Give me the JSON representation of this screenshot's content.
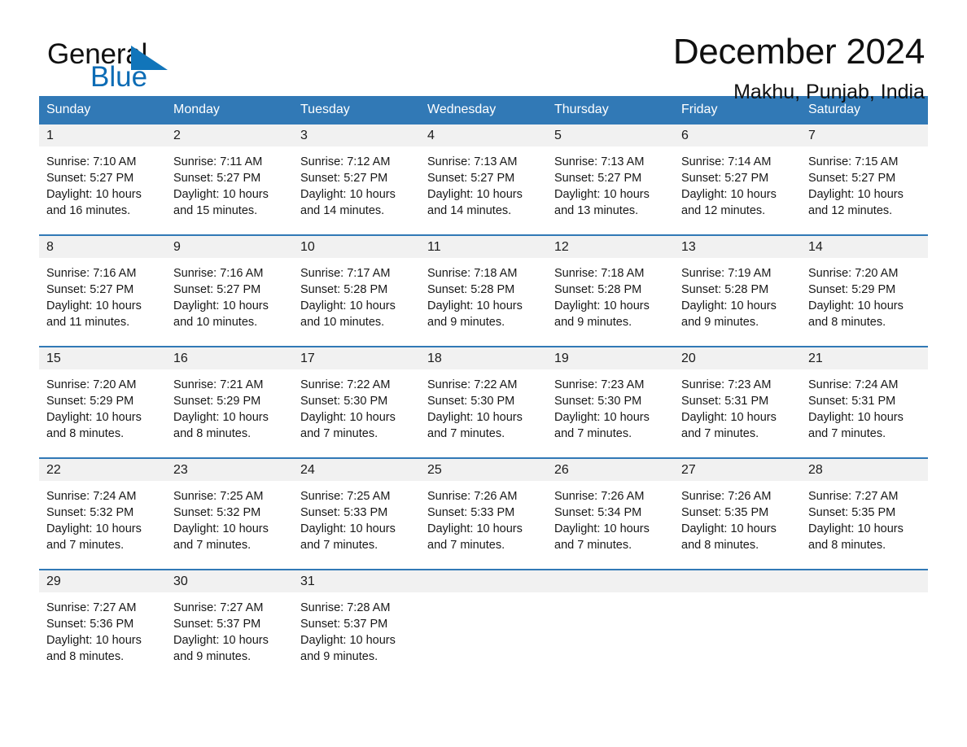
{
  "brand": {
    "word_one": "General",
    "word_two": "Blue",
    "logo_icon": "triangle-flag-icon"
  },
  "header": {
    "title": "December 2024",
    "subtitle": "Makhu, Punjab, India"
  },
  "colors": {
    "header_blue": "#3179b6",
    "brand_blue": "#0c6cb5",
    "date_band": "#f1f1f1",
    "text": "#181818"
  },
  "weekdays": [
    "Sunday",
    "Monday",
    "Tuesday",
    "Wednesday",
    "Thursday",
    "Friday",
    "Saturday"
  ],
  "weeks": [
    {
      "days": [
        {
          "date": "1",
          "lines": [
            "Sunrise: 7:10 AM",
            "Sunset: 5:27 PM",
            "Daylight: 10 hours",
            "and 16 minutes."
          ]
        },
        {
          "date": "2",
          "lines": [
            "Sunrise: 7:11 AM",
            "Sunset: 5:27 PM",
            "Daylight: 10 hours",
            "and 15 minutes."
          ]
        },
        {
          "date": "3",
          "lines": [
            "Sunrise: 7:12 AM",
            "Sunset: 5:27 PM",
            "Daylight: 10 hours",
            "and 14 minutes."
          ]
        },
        {
          "date": "4",
          "lines": [
            "Sunrise: 7:13 AM",
            "Sunset: 5:27 PM",
            "Daylight: 10 hours",
            "and 14 minutes."
          ]
        },
        {
          "date": "5",
          "lines": [
            "Sunrise: 7:13 AM",
            "Sunset: 5:27 PM",
            "Daylight: 10 hours",
            "and 13 minutes."
          ]
        },
        {
          "date": "6",
          "lines": [
            "Sunrise: 7:14 AM",
            "Sunset: 5:27 PM",
            "Daylight: 10 hours",
            "and 12 minutes."
          ]
        },
        {
          "date": "7",
          "lines": [
            "Sunrise: 7:15 AM",
            "Sunset: 5:27 PM",
            "Daylight: 10 hours",
            "and 12 minutes."
          ]
        }
      ]
    },
    {
      "days": [
        {
          "date": "8",
          "lines": [
            "Sunrise: 7:16 AM",
            "Sunset: 5:27 PM",
            "Daylight: 10 hours",
            "and 11 minutes."
          ]
        },
        {
          "date": "9",
          "lines": [
            "Sunrise: 7:16 AM",
            "Sunset: 5:27 PM",
            "Daylight: 10 hours",
            "and 10 minutes."
          ]
        },
        {
          "date": "10",
          "lines": [
            "Sunrise: 7:17 AM",
            "Sunset: 5:28 PM",
            "Daylight: 10 hours",
            "and 10 minutes."
          ]
        },
        {
          "date": "11",
          "lines": [
            "Sunrise: 7:18 AM",
            "Sunset: 5:28 PM",
            "Daylight: 10 hours",
            "and 9 minutes."
          ]
        },
        {
          "date": "12",
          "lines": [
            "Sunrise: 7:18 AM",
            "Sunset: 5:28 PM",
            "Daylight: 10 hours",
            "and 9 minutes."
          ]
        },
        {
          "date": "13",
          "lines": [
            "Sunrise: 7:19 AM",
            "Sunset: 5:28 PM",
            "Daylight: 10 hours",
            "and 9 minutes."
          ]
        },
        {
          "date": "14",
          "lines": [
            "Sunrise: 7:20 AM",
            "Sunset: 5:29 PM",
            "Daylight: 10 hours",
            "and 8 minutes."
          ]
        }
      ]
    },
    {
      "days": [
        {
          "date": "15",
          "lines": [
            "Sunrise: 7:20 AM",
            "Sunset: 5:29 PM",
            "Daylight: 10 hours",
            "and 8 minutes."
          ]
        },
        {
          "date": "16",
          "lines": [
            "Sunrise: 7:21 AM",
            "Sunset: 5:29 PM",
            "Daylight: 10 hours",
            "and 8 minutes."
          ]
        },
        {
          "date": "17",
          "lines": [
            "Sunrise: 7:22 AM",
            "Sunset: 5:30 PM",
            "Daylight: 10 hours",
            "and 7 minutes."
          ]
        },
        {
          "date": "18",
          "lines": [
            "Sunrise: 7:22 AM",
            "Sunset: 5:30 PM",
            "Daylight: 10 hours",
            "and 7 minutes."
          ]
        },
        {
          "date": "19",
          "lines": [
            "Sunrise: 7:23 AM",
            "Sunset: 5:30 PM",
            "Daylight: 10 hours",
            "and 7 minutes."
          ]
        },
        {
          "date": "20",
          "lines": [
            "Sunrise: 7:23 AM",
            "Sunset: 5:31 PM",
            "Daylight: 10 hours",
            "and 7 minutes."
          ]
        },
        {
          "date": "21",
          "lines": [
            "Sunrise: 7:24 AM",
            "Sunset: 5:31 PM",
            "Daylight: 10 hours",
            "and 7 minutes."
          ]
        }
      ]
    },
    {
      "days": [
        {
          "date": "22",
          "lines": [
            "Sunrise: 7:24 AM",
            "Sunset: 5:32 PM",
            "Daylight: 10 hours",
            "and 7 minutes."
          ]
        },
        {
          "date": "23",
          "lines": [
            "Sunrise: 7:25 AM",
            "Sunset: 5:32 PM",
            "Daylight: 10 hours",
            "and 7 minutes."
          ]
        },
        {
          "date": "24",
          "lines": [
            "Sunrise: 7:25 AM",
            "Sunset: 5:33 PM",
            "Daylight: 10 hours",
            "and 7 minutes."
          ]
        },
        {
          "date": "25",
          "lines": [
            "Sunrise: 7:26 AM",
            "Sunset: 5:33 PM",
            "Daylight: 10 hours",
            "and 7 minutes."
          ]
        },
        {
          "date": "26",
          "lines": [
            "Sunrise: 7:26 AM",
            "Sunset: 5:34 PM",
            "Daylight: 10 hours",
            "and 7 minutes."
          ]
        },
        {
          "date": "27",
          "lines": [
            "Sunrise: 7:26 AM",
            "Sunset: 5:35 PM",
            "Daylight: 10 hours",
            "and 8 minutes."
          ]
        },
        {
          "date": "28",
          "lines": [
            "Sunrise: 7:27 AM",
            "Sunset: 5:35 PM",
            "Daylight: 10 hours",
            "and 8 minutes."
          ]
        }
      ]
    },
    {
      "days": [
        {
          "date": "29",
          "lines": [
            "Sunrise: 7:27 AM",
            "Sunset: 5:36 PM",
            "Daylight: 10 hours",
            "and 8 minutes."
          ]
        },
        {
          "date": "30",
          "lines": [
            "Sunrise: 7:27 AM",
            "Sunset: 5:37 PM",
            "Daylight: 10 hours",
            "and 9 minutes."
          ]
        },
        {
          "date": "31",
          "lines": [
            "Sunrise: 7:28 AM",
            "Sunset: 5:37 PM",
            "Daylight: 10 hours",
            "and 9 minutes."
          ]
        },
        {
          "date": "",
          "lines": []
        },
        {
          "date": "",
          "lines": []
        },
        {
          "date": "",
          "lines": []
        },
        {
          "date": "",
          "lines": []
        }
      ]
    }
  ]
}
